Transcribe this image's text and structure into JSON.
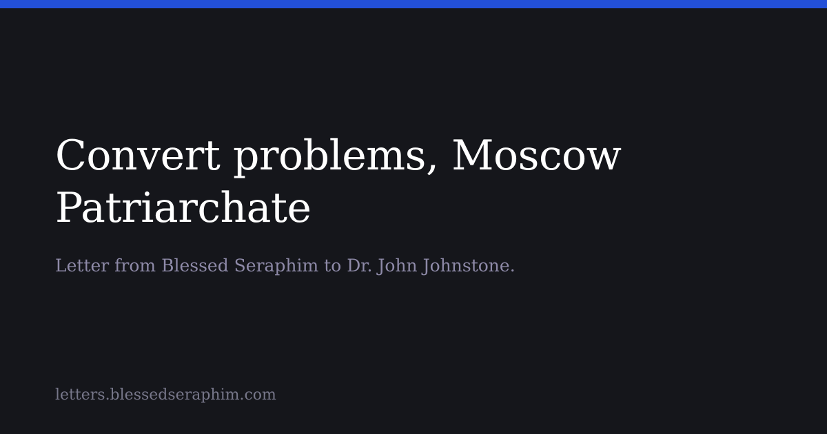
{
  "card": {
    "title_lines": [
      "Convert problems, Moscow",
      "Patriarchate"
    ],
    "subtitle": "Letter from Blessed Seraphim to Dr. John Johnstone.",
    "site_domain": "letters.blessedseraphim.com"
  },
  "colors": {
    "background": "#15161b",
    "accent_bar": "#2350d8",
    "title": "#ffffff",
    "subtitle": "#8e8aa8",
    "domain": "#77778a"
  }
}
